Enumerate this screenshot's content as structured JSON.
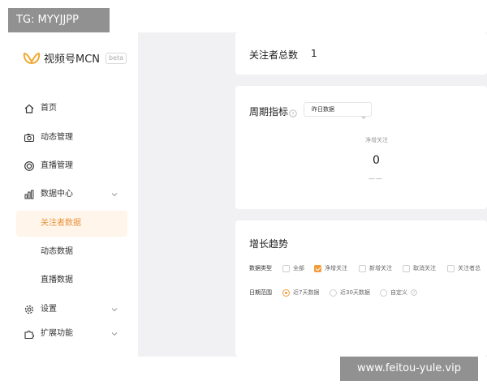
{
  "brand": {
    "name": "视频号MCN",
    "badge": "beta"
  },
  "sidebar": {
    "items": [
      {
        "label": "首页",
        "icon": "home-icon"
      },
      {
        "label": "动态管理",
        "icon": "camera-icon"
      },
      {
        "label": "直播管理",
        "icon": "live-circle-icon"
      },
      {
        "label": "数据中心",
        "icon": "bar-chart-icon",
        "expanded": true
      },
      {
        "label": "设置",
        "icon": "gear-icon"
      },
      {
        "label": "扩展功能",
        "icon": "puzzle-icon"
      }
    ],
    "sub_items": [
      {
        "label": "关注者数据",
        "active": true
      },
      {
        "label": "动态数据"
      },
      {
        "label": "直播数据"
      }
    ]
  },
  "followers_total": {
    "label": "关注者总数",
    "value": "1"
  },
  "period_metrics": {
    "title": "周期指标",
    "period_select": "昨日数据",
    "metric_label": "净增关注",
    "metric_value": "0",
    "metric_change": "——"
  },
  "growth_trend": {
    "title": "增长趋势",
    "data_type_label": "数据类型",
    "data_type_options": [
      {
        "label": "全部",
        "checked": false
      },
      {
        "label": "净增关注",
        "checked": true
      },
      {
        "label": "新增关注",
        "checked": false
      },
      {
        "label": "取消关注",
        "checked": false
      },
      {
        "label": "关注者总",
        "checked": false
      }
    ],
    "date_range_label": "日期范围",
    "date_range_options": [
      {
        "label": "近7天数据",
        "selected": true
      },
      {
        "label": "近30天数据",
        "selected": false
      },
      {
        "label": "自定义",
        "selected": false
      }
    ]
  },
  "watermarks": {
    "top": "TG: MYYJJPP",
    "bottom": "www.feitou-yule.vip"
  },
  "colors": {
    "accent": "#f39b3a",
    "active_bg": "#fff5ea",
    "active_text": "#e8923b",
    "main_bg": "#f1f1f3"
  }
}
